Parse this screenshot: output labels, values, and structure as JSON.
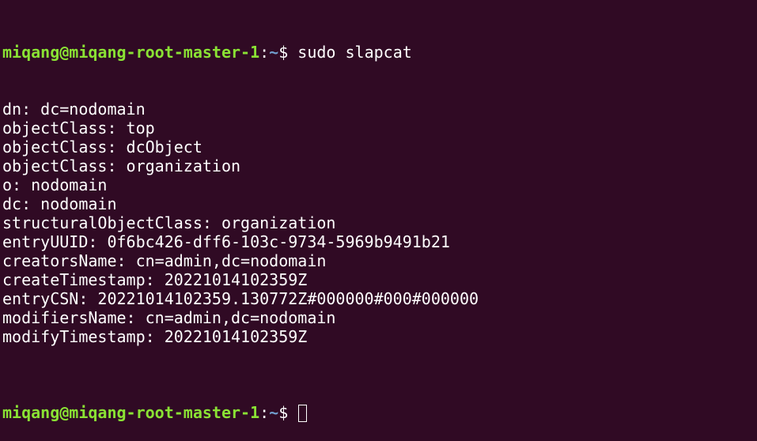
{
  "window": {
    "background": "#300a24",
    "prompt_color": "#8ae234",
    "path_color": "#729fcf",
    "text_color": "#ffffff"
  },
  "prompt": {
    "user_host": "miqang@miqang-root-master-1",
    "separator": ":",
    "path": "~",
    "symbol": "$ "
  },
  "command": "sudo slapcat",
  "output": [
    "dn: dc=nodomain",
    "objectClass: top",
    "objectClass: dcObject",
    "objectClass: organization",
    "o: nodomain",
    "dc: nodomain",
    "structuralObjectClass: organization",
    "entryUUID: 0f6bc426-dff6-103c-9734-5969b9491b21",
    "creatorsName: cn=admin,dc=nodomain",
    "createTimestamp: 20221014102359Z",
    "entryCSN: 20221014102359.130772Z#000000#000#000000",
    "modifiersName: cn=admin,dc=nodomain",
    "modifyTimestamp: 20221014102359Z",
    ""
  ]
}
